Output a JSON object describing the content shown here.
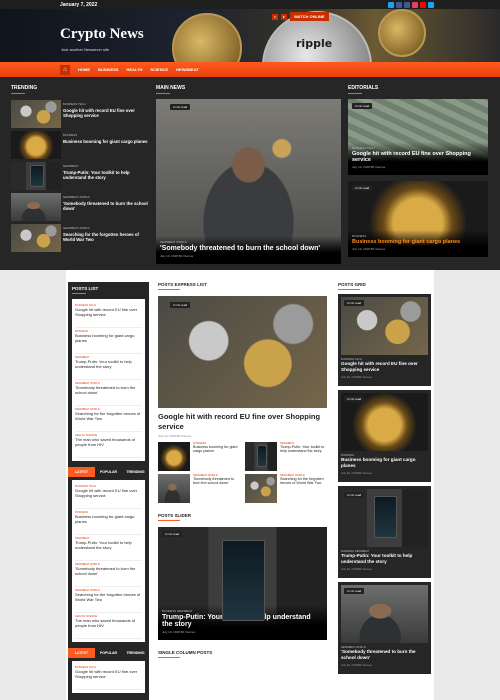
{
  "topbar": {
    "date": "January 7, 2022"
  },
  "site": {
    "title": "Crypto News",
    "tagline": "Just another Newsever site",
    "hero_text": "ripple"
  },
  "nav": {
    "items": [
      "HOME",
      "BUSINESS",
      "HEALTH",
      "SCIENCE",
      "NEWSBEAT"
    ],
    "watch": "WATCH ONLINE"
  },
  "trending": {
    "heading": "TRENDING",
    "items": [
      {
        "tags": "BUSINESS  TECH",
        "title": "Google hit with record EU fine over Shopping service"
      },
      {
        "tags": "BUSINESS",
        "title": "Business booming for giant cargo planes"
      },
      {
        "tags": "NEWSBEAT",
        "title": "Trump-Putin: Your toolkit to help understand the story"
      },
      {
        "tags": "NEWSBEAT  WORLD",
        "title": "'Somebody threatened to burn the school down'"
      },
      {
        "tags": "NEWSBEAT  WORLD",
        "title": "Searching for the forgotten heroes of World War Two"
      }
    ]
  },
  "main_news": {
    "heading": "MAIN NEWS",
    "badge": "2 min read",
    "tags": "NEWSBEAT  WORLD",
    "title": "'Somebody threatened to burn the school down'",
    "meta": "July 10, 2018   BF themes"
  },
  "editorials": {
    "heading": "EDITORIALS",
    "items": [
      {
        "badge": "2 min read",
        "tags": "BUSINESS  TECH",
        "title": "Google hit with record EU fine over Shopping service",
        "meta": "July 10, 2018   BF themes"
      },
      {
        "badge": "2 min read",
        "tags": "BUSINESS",
        "title": "Business booming for giant cargo planes",
        "meta": "July 10, 2018   BF themes"
      }
    ]
  },
  "posts_list": {
    "heading": "POSTS LIST",
    "items": [
      {
        "tags": "BUSINESS  TECH",
        "title": "Google hit with record EU fine over Shopping service"
      },
      {
        "tags": "BUSINESS",
        "title": "Business booming for giant cargo planes"
      },
      {
        "tags": "NEWSBEAT",
        "title": "Trump-Putin: Your toolkit to help understand the story"
      },
      {
        "tags": "NEWSBEAT  WORLD",
        "title": "'Somebody threatened to burn the school down'"
      },
      {
        "tags": "NEWSBEAT  WORLD",
        "title": "Searching for the forgotten heroes of World War Two"
      },
      {
        "tags": "HEALTH  SCIENCE",
        "title": "The man who saved thousands of people from HIV"
      }
    ]
  },
  "tabs": [
    "LATEST",
    "POPULAR",
    "TRENDING"
  ],
  "latest_list": {
    "items": [
      {
        "tags": "BUSINESS  TECH",
        "title": "Google hit with record EU fine over Shopping service"
      },
      {
        "tags": "BUSINESS",
        "title": "Business booming for giant cargo planes"
      },
      {
        "tags": "NEWSBEAT",
        "title": "Trump-Putin: Your toolkit to help understand the story"
      },
      {
        "tags": "NEWSBEAT  WORLD",
        "title": "'Somebody threatened to burn the school down'"
      },
      {
        "tags": "NEWSBEAT  WORLD",
        "title": "Searching for the forgotten heroes of World War Two"
      },
      {
        "tags": "HEALTH  SCIENCE",
        "title": "The man who saved thousands of people from HIV"
      }
    ]
  },
  "latest_list2": {
    "items": [
      {
        "tags": "BUSINESS  TECH",
        "title": "Google hit with record EU fine over Shopping service"
      }
    ]
  },
  "express": {
    "heading": "POSTS EXPRESS LIST",
    "badge": "2 min read",
    "title": "Google hit with record EU fine over Shopping service",
    "meta": "July 10, 2018   BF themes",
    "small": [
      {
        "tags": "BUSINESS",
        "title": "Business booming for giant cargo planes"
      },
      {
        "tags": "NEWSBEAT",
        "title": "Trump-Putin: Your toolkit to help understand the story"
      },
      {
        "tags": "NEWSBEAT  WORLD",
        "title": "'Somebody threatened to burn the school down'"
      },
      {
        "tags": "NEWSBEAT  WORLD",
        "title": "Searching for the forgotten heroes of World War Two"
      }
    ]
  },
  "slider": {
    "heading": "POSTS SLIDER",
    "badge": "2 min read",
    "tags": "BUSINESS  NEWSBEAT",
    "title": "Trump-Putin: Your toolkit to help understand the story",
    "meta": "July 10, 2018   BF themes"
  },
  "single": {
    "heading": "SINGLE COLUMN POSTS"
  },
  "grid": {
    "heading": "POSTS GRID",
    "items": [
      {
        "badge": "2 min read",
        "tags": "BUSINESS  TECH",
        "title": "Google hit with record EU fine over Shopping service",
        "meta": "July 10, 2018   BF themes"
      },
      {
        "badge": "2 min read",
        "tags": "BUSINESS",
        "title": "Business booming for giant cargo planes",
        "meta": "July 10, 2018   BF themes"
      },
      {
        "badge": "2 min read",
        "tags": "BUSINESS  NEWSBEAT",
        "title": "Trump-Putin: Your toolkit to help understand the story",
        "meta": "July 10, 2018   BF themes"
      },
      {
        "badge": "2 min read",
        "tags": "NEWSBEAT  WORLD",
        "title": "'Somebody threatened to burn the school down'",
        "meta": "July 10, 2018   BF themes"
      }
    ]
  },
  "colors": {
    "accent": "#ff5a1f",
    "dark": "#262626"
  }
}
